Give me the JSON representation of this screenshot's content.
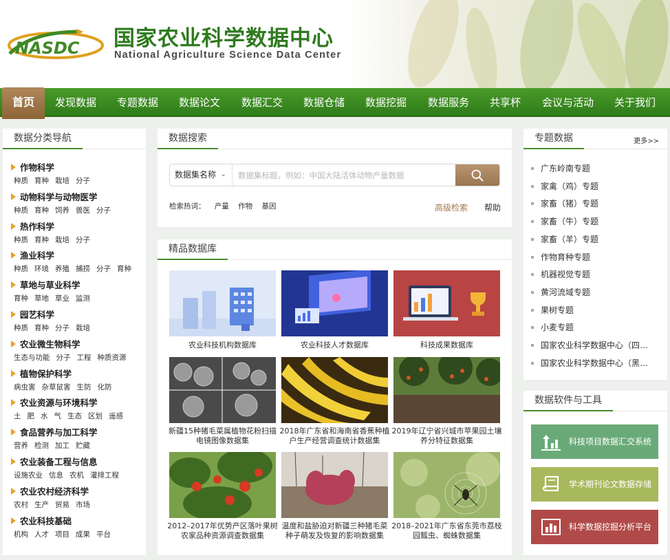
{
  "site": {
    "title_cn": "国家农业科学数据中心",
    "title_en": "National Agriculture Science Data Center",
    "logo_text": "NASDC"
  },
  "colors": {
    "nav_green": "#3a8a22",
    "home_brown": "#9b7245",
    "accent_orange": "#e9a22a"
  },
  "nav": {
    "home": "首页",
    "items": [
      "发现数据",
      "专题数据",
      "数据论文",
      "数据汇交",
      "数据仓储",
      "数据挖掘",
      "数据服务",
      "共享杯",
      "会议与活动",
      "关于我们"
    ]
  },
  "left": {
    "title": "数据分类导航",
    "categories": [
      {
        "name": "作物科学",
        "subs": [
          "种质",
          "育种",
          "栽培",
          "分子"
        ]
      },
      {
        "name": "动物科学与动物医学",
        "subs": [
          "种质",
          "育种",
          "饲养",
          "兽医",
          "分子"
        ]
      },
      {
        "name": "热作科学",
        "subs": [
          "种质",
          "育种",
          "栽培",
          "分子"
        ]
      },
      {
        "name": "渔业科学",
        "subs": [
          "种质",
          "环境",
          "养殖",
          "捕捞",
          "分子",
          "育种"
        ]
      },
      {
        "name": "草地与草业科学",
        "subs": [
          "育种",
          "草地",
          "草业",
          "监测"
        ]
      },
      {
        "name": "园艺科学",
        "subs": [
          "种质",
          "育种",
          "分子",
          "栽培"
        ]
      },
      {
        "name": "农业微生物科学",
        "subs": [
          "生态与功能",
          "分子",
          "工程",
          "种质资源"
        ]
      },
      {
        "name": "植物保护科学",
        "subs": [
          "病虫害",
          "杂草鼠害",
          "生防",
          "化防"
        ]
      },
      {
        "name": "农业资源与环境科学",
        "subs": [
          "土",
          "肥",
          "水",
          "气",
          "生态",
          "区划",
          "遥感"
        ]
      },
      {
        "name": "食品营养与加工科学",
        "subs": [
          "营养",
          "检测",
          "加工",
          "贮藏"
        ]
      },
      {
        "name": "农业装备工程与信息",
        "subs": [
          "设施农业",
          "信息",
          "农机",
          "灌排工程"
        ]
      },
      {
        "name": "农业农村经济科学",
        "subs": [
          "农村",
          "生产",
          "贸易",
          "市场"
        ]
      },
      {
        "name": "农业科技基础",
        "subs": [
          "机构",
          "人才",
          "项目",
          "成果",
          "平台"
        ]
      }
    ]
  },
  "search": {
    "title": "数据搜索",
    "select_label": "数据集名称",
    "placeholder": "数据集标题，例如：中国大陆活体动物产量数据",
    "hot_label": "检索热词：",
    "hot_words": [
      "产量",
      "作物",
      "基因"
    ],
    "advanced": "高级检索",
    "help": "帮助"
  },
  "gallery": {
    "title": "精品数据库",
    "cards": [
      {
        "caption": "农业科技机构数据库"
      },
      {
        "caption": "农业科技人才数据库"
      },
      {
        "caption": "科技成果数据库"
      },
      {
        "caption": "新疆15种猪毛菜属植物花粉扫描电镜图像数据集"
      },
      {
        "caption": "2018年广东省和海南省香蕉种植户生产经营调查统计数据集"
      },
      {
        "caption": "2019年辽宁省兴城市苹果园土壤养分特征数据集"
      },
      {
        "caption": "2012–2017年优势产区落叶果树农家品种资源调查数据集"
      },
      {
        "caption": "温度和盐胁迫对新疆三种猪毛菜种子萌发及恢复的影响数据集"
      },
      {
        "caption": "2018–2021年广东省东莞市荔枝园瓢虫、蜘蛛数据集"
      }
    ]
  },
  "topics": {
    "title": "专题数据",
    "more": "更多>>",
    "items": [
      "广东岭南专题",
      "家禽（鸡）专题",
      "家畜（猪）专题",
      "家畜（牛）专题",
      "家畜（羊）专题",
      "作物育种专题",
      "机器视觉专题",
      "黄河流域专题",
      "果树专题",
      "小麦专题",
      "国家农业科学数据中心（四川）",
      "国家农业科学数据中心（黑龙江）"
    ]
  },
  "tools": {
    "title": "数据软件与工具",
    "items": [
      {
        "label": "科技项目数据汇交系统",
        "icon": "upload-chart-icon",
        "color": "#6aaa78"
      },
      {
        "label": "学术期刊论文数据存储",
        "icon": "book-icon",
        "color": "#a8b85c"
      },
      {
        "label": "科学数据挖掘分析平台",
        "icon": "bar-chart-icon",
        "color": "#b04a48"
      }
    ]
  }
}
